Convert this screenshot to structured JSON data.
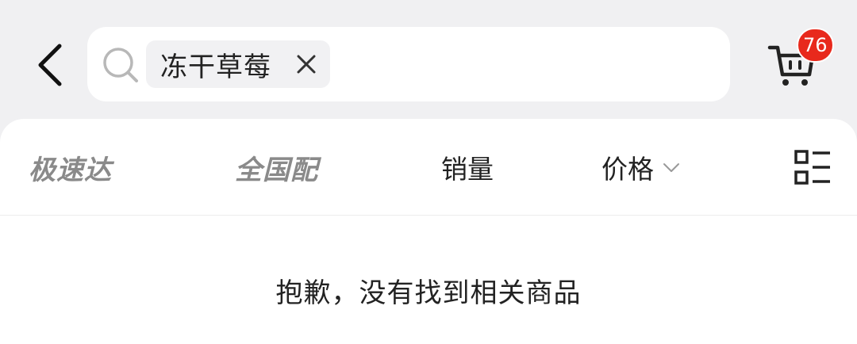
{
  "header": {
    "back_icon": "chevron-left-icon",
    "search": {
      "icon": "search-icon",
      "tag_text": "冻干草莓",
      "tag_close_icon": "close-icon"
    },
    "cart": {
      "icon": "cart-icon",
      "badge_count": "76",
      "badge_color": "#e8291c"
    }
  },
  "filters": {
    "express": "极速达",
    "nationwide": "全国配",
    "sales": "销量",
    "price": "价格",
    "price_icon": "chevron-down-icon",
    "layout_icon": "list-layout-icon"
  },
  "results": {
    "empty_message": "抱歉，没有找到相关商品"
  }
}
